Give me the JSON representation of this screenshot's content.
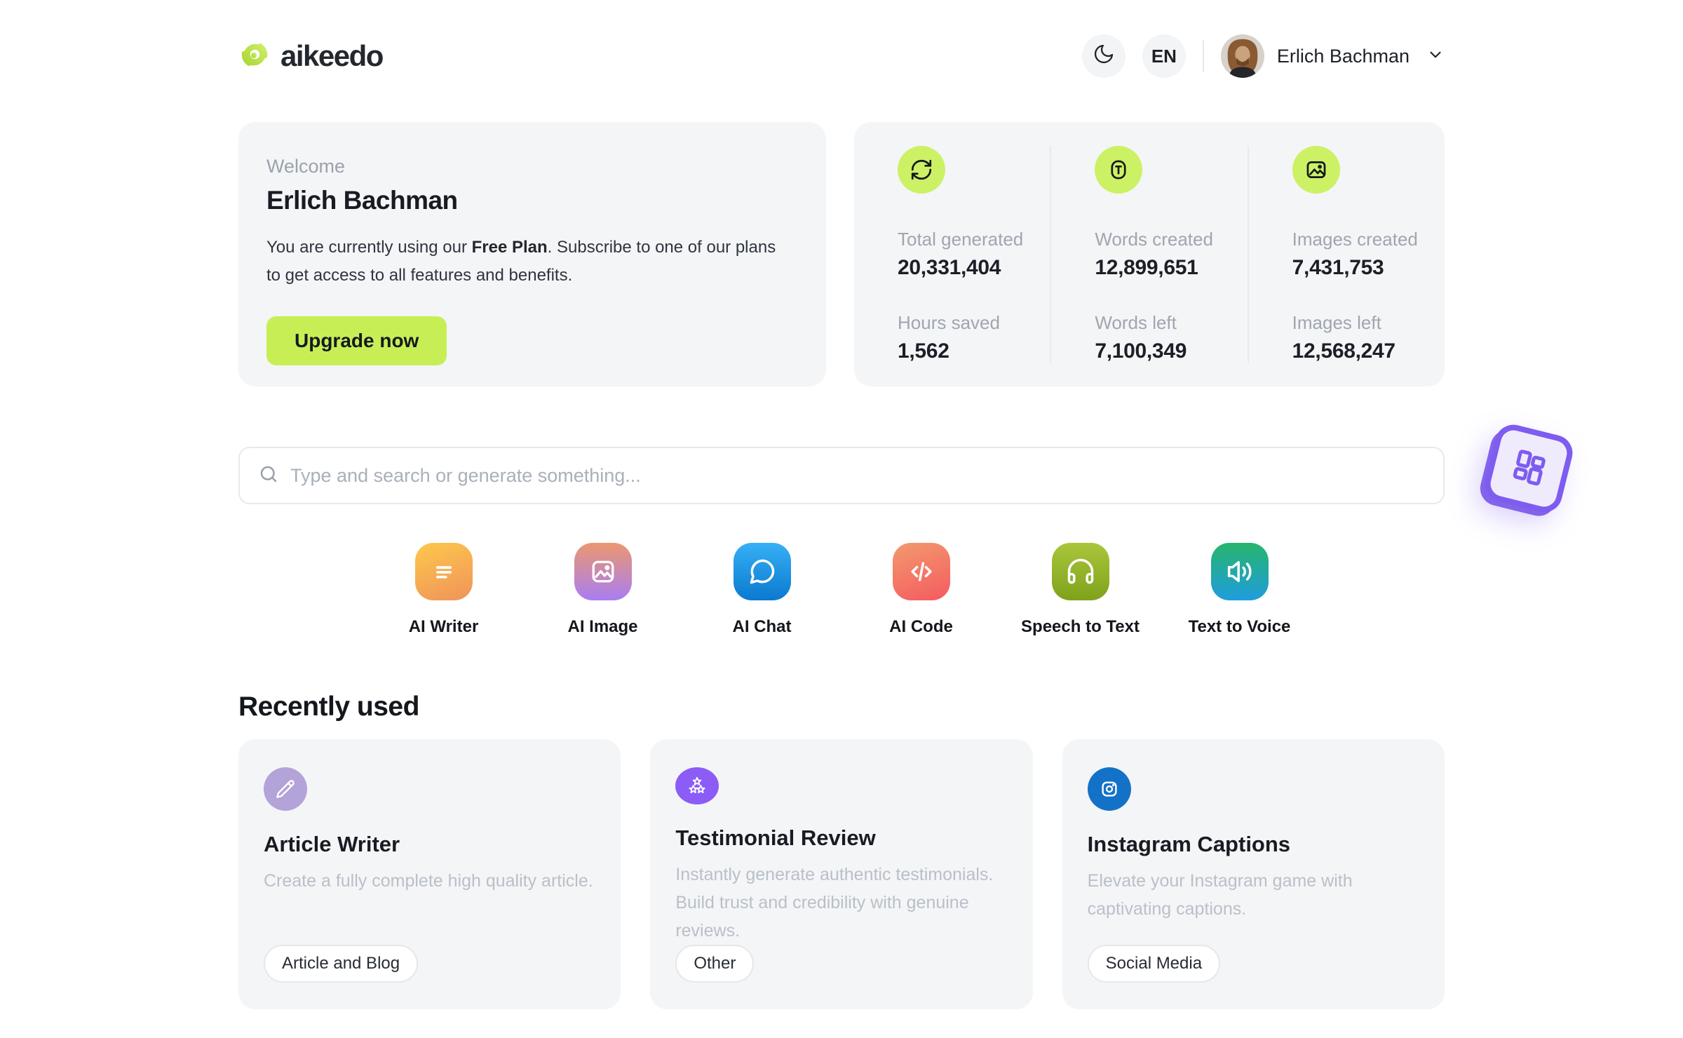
{
  "header": {
    "logo_text": "aikeedo",
    "language": "EN",
    "user_name": "Erlich Bachman",
    "icons": [
      "moon-icon",
      "chevron-down-icon"
    ]
  },
  "welcome": {
    "eyebrow": "Welcome",
    "name": "Erlich Bachman",
    "message_prefix": "You are currently using our ",
    "plan": "Free Plan",
    "message_after_plan": ". Subscribe to one of our plans",
    "message_line2": "to get access to all features and benefits.",
    "cta": "Upgrade now",
    "cta_color": "#c7ef55"
  },
  "stats": {
    "icon_bg": "#ccf164",
    "columns": [
      {
        "icon": "sync-icon",
        "top_label": "Total generated",
        "top_value": "20,331,404",
        "bottom_label": "Hours saved",
        "bottom_value": "1,562"
      },
      {
        "icon": "letter-t-icon",
        "top_label": "Words created",
        "top_value": "12,899,651",
        "bottom_label": "Words left",
        "bottom_value": "7,100,349"
      },
      {
        "icon": "image-icon",
        "top_label": "Images created",
        "top_value": "7,431,753",
        "bottom_label": "Images left",
        "bottom_value": "12,568,247"
      }
    ]
  },
  "search": {
    "placeholder": "Type and search or generate something...",
    "icon": "search-icon"
  },
  "floating_widget": {
    "icon": "apps-grid-icon",
    "color": "#7e5cf0"
  },
  "tools": [
    {
      "label": "AI Writer",
      "icon": "writer-icon",
      "gradient": [
        "#fdc84b",
        "#f0935b"
      ]
    },
    {
      "label": "AI Image",
      "icon": "image-icon",
      "gradient": [
        "#eb9770",
        "#a97df2"
      ]
    },
    {
      "label": "AI Chat",
      "icon": "chat-icon",
      "gradient": [
        "#36b0f6",
        "#0b79cf"
      ]
    },
    {
      "label": "AI Code",
      "icon": "code-icon",
      "gradient": [
        "#f29a6e",
        "#f55a60"
      ]
    },
    {
      "label": "Speech to Text",
      "icon": "headphones-icon",
      "gradient": [
        "#a9c63c",
        "#7fa21b"
      ]
    },
    {
      "label": "Text to Voice",
      "icon": "volume-icon",
      "gradient": [
        "#27b56d",
        "#1f9ddd"
      ]
    }
  ],
  "recent": {
    "heading": "Recently used",
    "cards": [
      {
        "title": "Article Writer",
        "description": "Create a fully complete high quality article.",
        "tag": "Article and Blog",
        "icon": "pencil-icon",
        "icon_bg": "#b3a3d9"
      },
      {
        "title": "Testimonial Review",
        "description": "Instantly generate authentic testimonials. Build trust and credibility with genuine reviews.",
        "tag": "Other",
        "icon": "stars-icon",
        "icon_bg": "#8b5cf6"
      },
      {
        "title": "Instagram Captions",
        "description": "Elevate your Instagram game with captivating captions.",
        "tag": "Social Media",
        "icon": "instagram-icon",
        "icon_bg": "#1372c8"
      }
    ]
  }
}
